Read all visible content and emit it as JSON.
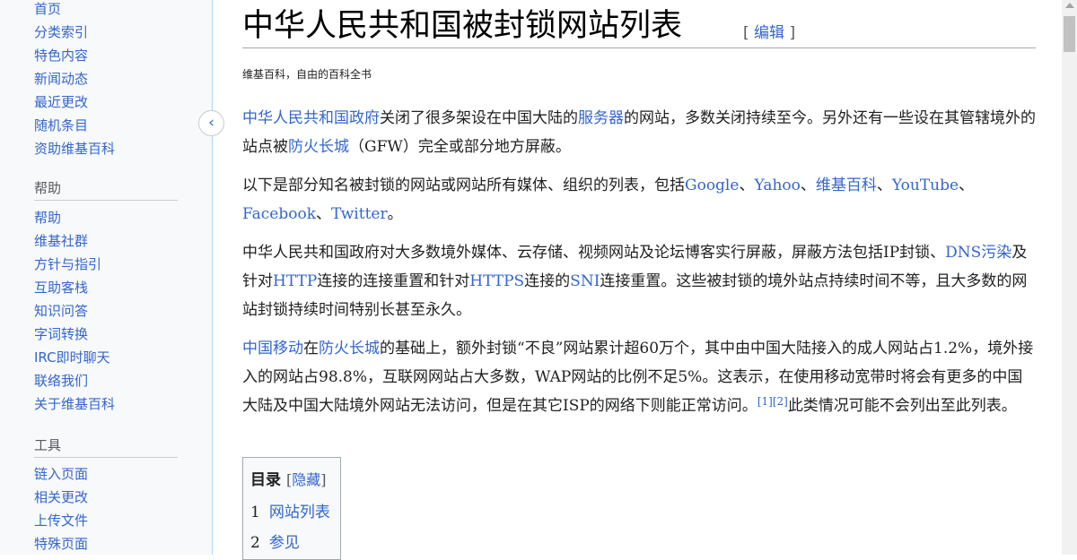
{
  "sidebar": {
    "nav_items": [
      "首页",
      "分类索引",
      "特色内容",
      "新闻动态",
      "最近更改",
      "随机条目",
      "资助维基百科"
    ],
    "help_heading": "帮助",
    "help_items": [
      "帮助",
      "维基社群",
      "方针与指引",
      "互助客栈",
      "知识问答",
      "字词转换",
      "IRC即时聊天",
      "联络我们",
      "关于维基百科"
    ],
    "tools_heading": "工具",
    "tools_items": [
      "链入页面",
      "相关更改",
      "上传文件",
      "特殊页面"
    ]
  },
  "collapse_icon": "chevron-left-icon",
  "page": {
    "title": "中华人民共和国被封锁网站列表",
    "edit_open": "[",
    "edit_label": "编辑",
    "edit_close": "]",
    "tagline": "维基百科，自由的百科全书"
  },
  "paragraphs": {
    "p1": {
      "l1": "中华人民共和国政府",
      "t1": "关闭了很多架设在中国大陆的",
      "l2": "服务器",
      "t2": "的网站，多数关闭持续至今。另外还有一些设在其管辖境外的站点被",
      "l3": "防火长城",
      "t3": "（GFW）完全或部分地方屏蔽。"
    },
    "p2": {
      "t1": "以下是部分知名被封锁的网站或网站所有媒体、组织的列表，包括",
      "l1": "Google",
      "s1": "、",
      "l2": "Yahoo",
      "s2": "、",
      "l3": "维基百科",
      "s3": "、",
      "l4": "YouTube",
      "s4": "、",
      "l5": "Facebook",
      "s5": "、",
      "l6": "Twitter",
      "s6": "。"
    },
    "p3": {
      "t1": "中华人民共和国政府对大多数境外媒体、云存储、视频网站及论坛博客实行屏蔽，屏蔽方法包括IP封锁、",
      "l1": "DNS污染",
      "t2": "及针对",
      "l2": "HTTP",
      "t3": "连接的连接重置和针对",
      "l3": "HTTPS",
      "t4": "连接的",
      "l4": "SNI",
      "t5": "连接重置。这些被封锁的境外站点持续时间不等，且大多数的网站封锁持续时间特别长甚至永久。"
    },
    "p4": {
      "l1": "中国移动",
      "t1": "在",
      "l2": "防火长城",
      "t2": "的基础上，额外封锁“不良”网站累计超60万个，其中由中国大陆接入的成人网站占1.2%，境外接入的网站占98.8%，互联网网站占大多数，WAP网站的比例不足5%。这表示，在使用移动宽带时将会有更多的中国大陆及中国大陆境外网站无法访问，但是在其它ISP的网络下则能正常访问。",
      "ref1": "[1]",
      "ref2": "[2]",
      "t3": "此类情况可能不会列出至此列表。"
    }
  },
  "toc": {
    "title": "目录",
    "toggle_open": "[",
    "toggle_label": "隐藏",
    "toggle_close": "]",
    "items": [
      {
        "num": "1",
        "label": "网站列表"
      },
      {
        "num": "2",
        "label": "参见"
      }
    ]
  }
}
